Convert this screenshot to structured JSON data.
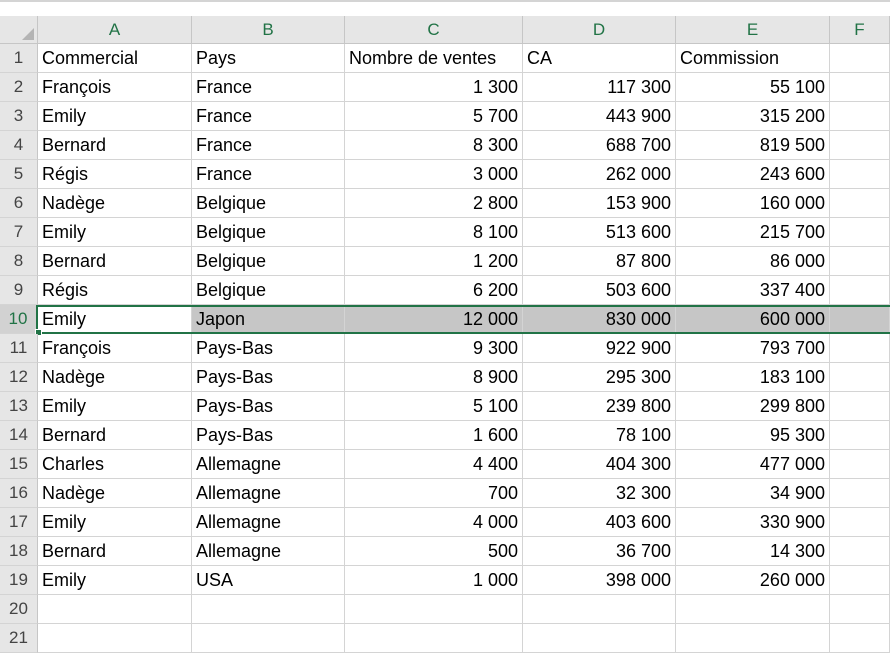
{
  "columns": [
    "A",
    "B",
    "C",
    "D",
    "E",
    "F"
  ],
  "rows": [
    {
      "n": "1",
      "cells": [
        "Commercial",
        "Pays",
        "Nombre de ventes",
        "CA",
        "Commission",
        ""
      ]
    },
    {
      "n": "2",
      "cells": [
        "François",
        "France",
        "1 300",
        "117 300",
        "55 100",
        ""
      ]
    },
    {
      "n": "3",
      "cells": [
        "Emily",
        "France",
        "5 700",
        "443 900",
        "315 200",
        ""
      ]
    },
    {
      "n": "4",
      "cells": [
        "Bernard",
        "France",
        "8 300",
        "688 700",
        "819 500",
        ""
      ]
    },
    {
      "n": "5",
      "cells": [
        "Régis",
        "France",
        "3 000",
        "262 000",
        "243 600",
        ""
      ]
    },
    {
      "n": "6",
      "cells": [
        "Nadège",
        "Belgique",
        "2 800",
        "153 900",
        "160 000",
        ""
      ]
    },
    {
      "n": "7",
      "cells": [
        "Emily",
        "Belgique",
        "8 100",
        "513 600",
        "215 700",
        ""
      ]
    },
    {
      "n": "8",
      "cells": [
        "Bernard",
        "Belgique",
        "1 200",
        "87 800",
        "86 000",
        ""
      ]
    },
    {
      "n": "9",
      "cells": [
        "Régis",
        "Belgique",
        "6 200",
        "503 600",
        "337 400",
        ""
      ]
    },
    {
      "n": "10",
      "cells": [
        "Emily",
        "Japon",
        "12 000",
        "830 000",
        "600 000",
        ""
      ]
    },
    {
      "n": "11",
      "cells": [
        "François",
        "Pays-Bas",
        "9 300",
        "922 900",
        "793 700",
        ""
      ]
    },
    {
      "n": "12",
      "cells": [
        "Nadège",
        "Pays-Bas",
        "8 900",
        "295 300",
        "183 100",
        ""
      ]
    },
    {
      "n": "13",
      "cells": [
        "Emily",
        "Pays-Bas",
        "5 100",
        "239 800",
        "299 800",
        ""
      ]
    },
    {
      "n": "14",
      "cells": [
        "Bernard",
        "Pays-Bas",
        "1 600",
        "78 100",
        "95 300",
        ""
      ]
    },
    {
      "n": "15",
      "cells": [
        "Charles",
        "Allemagne",
        "4 400",
        "404 300",
        "477 000",
        ""
      ]
    },
    {
      "n": "16",
      "cells": [
        "Nadège",
        "Allemagne",
        "700",
        "32 300",
        "34 900",
        ""
      ]
    },
    {
      "n": "17",
      "cells": [
        "Emily",
        "Allemagne",
        "4 000",
        "403 600",
        "330 900",
        ""
      ]
    },
    {
      "n": "18",
      "cells": [
        "Bernard",
        "Allemagne",
        "500",
        "36 700",
        "14 300",
        ""
      ]
    },
    {
      "n": "19",
      "cells": [
        "Emily",
        "USA",
        "1 000",
        "398 000",
        "260 000",
        ""
      ]
    },
    {
      "n": "20",
      "cells": [
        "",
        "",
        "",
        "",
        "",
        ""
      ]
    },
    {
      "n": "21",
      "cells": [
        "",
        "",
        "",
        "",
        "",
        ""
      ]
    }
  ],
  "selection": {
    "row": "10"
  },
  "colors": {
    "accent": "#217346",
    "selected_fill": "#c6c6c6"
  }
}
